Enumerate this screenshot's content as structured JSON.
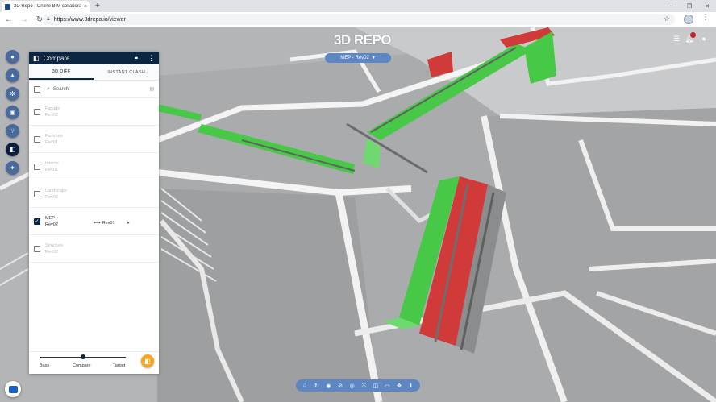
{
  "browser": {
    "tab_title": "3D Repo | Online BIM collaborat",
    "tab_close": "×",
    "new_tab": "+",
    "url": "https://www.3drepo.io/viewer",
    "win_minimize": "–",
    "win_maximize": "❐",
    "win_close": "✕",
    "menu": "⋮"
  },
  "viewer": {
    "logo": "3D REPO",
    "model_selector": "MEP - Rev02",
    "top_icons": [
      "list-icon",
      "notifications-icon",
      "account-icon"
    ]
  },
  "left_rail": {
    "items": [
      {
        "name": "issues",
        "icon": "place-icon",
        "glyph": "●",
        "active": false
      },
      {
        "name": "risks",
        "icon": "warning-icon",
        "glyph": "▲",
        "active": false
      },
      {
        "name": "groups",
        "icon": "groups-icon",
        "glyph": "✲",
        "active": false
      },
      {
        "name": "views",
        "icon": "camera-icon",
        "glyph": "◉",
        "active": false
      },
      {
        "name": "tree",
        "icon": "tree-icon",
        "glyph": "⑂",
        "active": false
      },
      {
        "name": "compare",
        "icon": "compare-icon",
        "glyph": "◧",
        "active": true
      },
      {
        "name": "gis",
        "icon": "gis-icon",
        "glyph": "✦",
        "active": false
      }
    ]
  },
  "compare_panel": {
    "title": "Compare",
    "tabs": [
      "3D DIFF",
      "INSTANT CLASH"
    ],
    "active_tab": 0,
    "search_label": "Search",
    "models": [
      {
        "name": "Facade",
        "revision": "Rev02",
        "checked": false
      },
      {
        "name": "Furniture",
        "revision": "Rev01",
        "checked": false
      },
      {
        "name": "Interior",
        "revision": "Rev01",
        "checked": false
      },
      {
        "name": "Landscape",
        "revision": "Rev02",
        "checked": false
      },
      {
        "name": "MEP",
        "revision": "Rev02",
        "checked": true,
        "target_revision": "Rev01"
      },
      {
        "name": "Structure",
        "revision": "Rev02",
        "checked": false
      }
    ],
    "slider": {
      "labels": [
        "Base",
        "Compare",
        "Target"
      ],
      "value": 0.5
    }
  },
  "bottom_toolbar": {
    "tools": [
      {
        "name": "home-icon",
        "glyph": "⌂"
      },
      {
        "name": "turntable-icon",
        "glyph": "↻"
      },
      {
        "name": "show-all-icon",
        "glyph": "◉"
      },
      {
        "name": "hide-icon",
        "glyph": "⊘"
      },
      {
        "name": "isolate-icon",
        "glyph": "◎"
      },
      {
        "name": "focus-icon",
        "glyph": "⤧"
      },
      {
        "name": "clip-icon",
        "glyph": "◫"
      },
      {
        "name": "measure-icon",
        "glyph": "▭"
      },
      {
        "name": "coordinates-icon",
        "glyph": "✥"
      },
      {
        "name": "metadata-icon",
        "glyph": "ℹ"
      }
    ]
  },
  "colors": {
    "panel_header": "#0c2541",
    "accent": "#5c87c2",
    "diff_added": "#47c847",
    "diff_removed": "#d03a38",
    "fab": "#f5a623"
  }
}
